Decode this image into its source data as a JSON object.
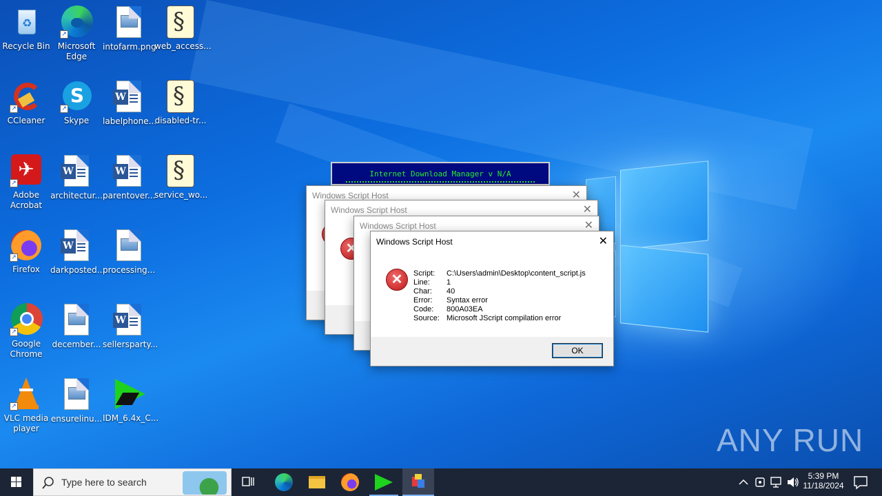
{
  "desktop": {
    "icons": [
      {
        "label": "Recycle Bin",
        "icon": "recycle-bin-icon"
      },
      {
        "label": "Microsoft Edge",
        "icon": "edge-icon"
      },
      {
        "label": "intofarm.png",
        "icon": "image-file-icon"
      },
      {
        "label": "web_access...",
        "icon": "script-file-icon"
      },
      {
        "label": "CCleaner",
        "icon": "ccleaner-icon"
      },
      {
        "label": "Skype",
        "icon": "skype-icon"
      },
      {
        "label": "labelphone...",
        "icon": "word-doc-icon"
      },
      {
        "label": "disabled-tr...",
        "icon": "script-file-icon"
      },
      {
        "label": "Adobe Acrobat",
        "icon": "acrobat-icon"
      },
      {
        "label": "architectur...",
        "icon": "word-doc-icon"
      },
      {
        "label": "parentover...",
        "icon": "word-doc-icon"
      },
      {
        "label": "service_wo...",
        "icon": "script-file-icon"
      },
      {
        "label": "Firefox",
        "icon": "firefox-icon"
      },
      {
        "label": "darkposted...",
        "icon": "word-doc-icon"
      },
      {
        "label": "processing...",
        "icon": "image-file-icon"
      },
      {
        "label": "Google Chrome",
        "icon": "chrome-icon"
      },
      {
        "label": "december...",
        "icon": "image-file-icon"
      },
      {
        "label": "sellersparty...",
        "icon": "word-doc-icon"
      },
      {
        "label": "VLC media player",
        "icon": "vlc-icon"
      },
      {
        "label": "ensurelinu...",
        "icon": "image-file-icon"
      },
      {
        "label": "IDM_6.4x_C...",
        "icon": "idm-icon"
      }
    ]
  },
  "idm_banner": {
    "text": "Internet Download Manager v N/A"
  },
  "dialogs": {
    "back_title": "Windows Script Host",
    "front": {
      "title": "Windows Script Host",
      "fields": [
        {
          "key": "Script:",
          "value": "C:\\Users\\admin\\Desktop\\content_script.js"
        },
        {
          "key": "Line:",
          "value": "1"
        },
        {
          "key": "Char:",
          "value": "40"
        },
        {
          "key": "Error:",
          "value": "Syntax error"
        },
        {
          "key": "Code:",
          "value": "800A03EA"
        },
        {
          "key": "Source:",
          "value": "Microsoft JScript compilation error"
        }
      ],
      "ok_label": "OK"
    }
  },
  "taskbar": {
    "search_placeholder": "Type here to search",
    "time": "5:39 PM",
    "date": "11/18/2024"
  },
  "watermark": "ANY RUN"
}
